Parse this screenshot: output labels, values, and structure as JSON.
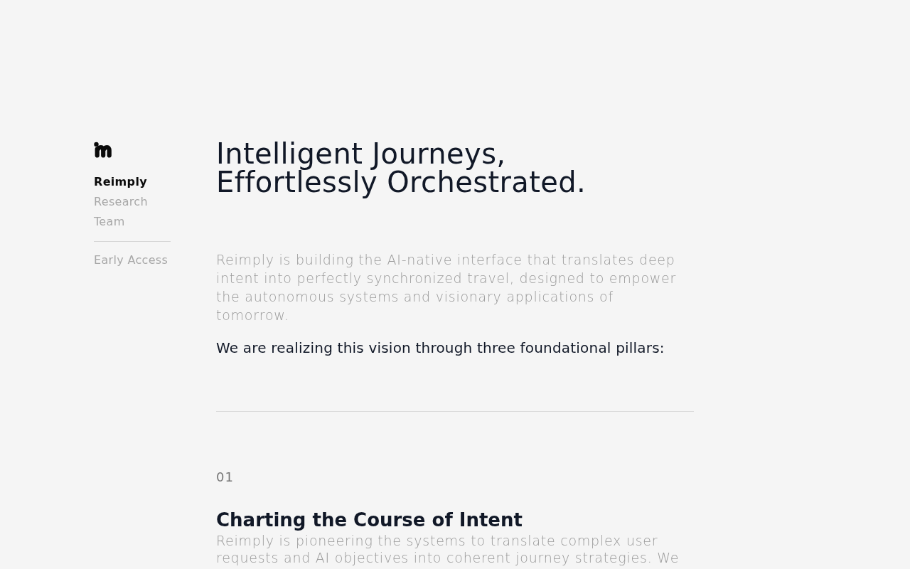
{
  "sidebar": {
    "nav": [
      {
        "label": "Reimply",
        "selected": true
      },
      {
        "label": "Research",
        "selected": false
      },
      {
        "label": "Team",
        "selected": false
      }
    ],
    "cta": "Early Access"
  },
  "hero": {
    "title_lines": [
      "Intelligent Journeys,",
      "Effortlessly Orchestrated."
    ],
    "intro": "Reimply is building the AI-native interface that translates deep intent into perfectly synchronized travel, designed to empower the autonomous systems and visionary applications of tomorrow.",
    "lead": "We are realizing this vision through three foundational pillars:"
  },
  "pillars": [
    {
      "number": "01",
      "title": "Charting the Course of Intent",
      "text": "Reimply is pioneering the systems to translate complex user requests and AI objectives into coherent journey strategies. We"
    }
  ]
}
